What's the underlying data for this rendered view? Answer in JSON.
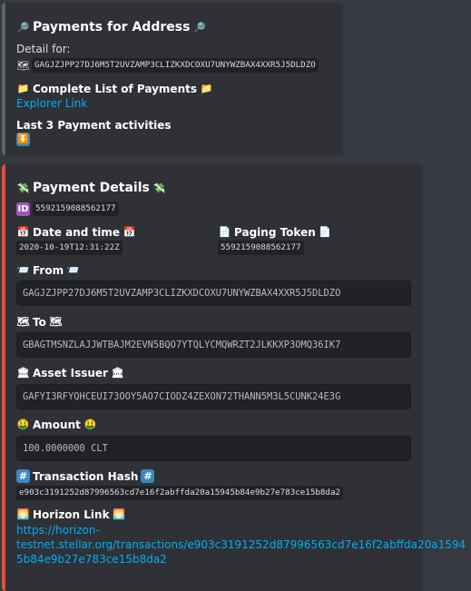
{
  "card1": {
    "title": "Payments for Address",
    "title_icon": "magnifier-icon",
    "detail_label": "Detail for:",
    "address_icon": "world-map-icon",
    "address": "GAGJZJPP27DJ6M5T2UVZAMP3CLIZKXDCOXU7UNYWZBAX4XXR5J5DLDZO",
    "list_title": "Complete List of Payments",
    "list_icon": "folder-icon",
    "explorer_link": "Explorer Link",
    "last_label": "Last 3 Payment activities",
    "last_icon": "double-down-arrow-icon"
  },
  "card2": {
    "accent_color": "#e74c3c",
    "title": "Payment Details",
    "title_icon": "money-with-wings-icon",
    "id_icon": "id-icon",
    "id": "5592159088562177",
    "date_label": "Date and time",
    "date_icon": "calendar-icon",
    "date_value": "2020-10-19T12:31:22Z",
    "paging_label": "Paging Token",
    "paging_icon": "page-icon",
    "paging_value": "5592159088562177",
    "from_label": "From",
    "from_icon": "incoming-envelope-icon",
    "from_value": "GAGJZJPP27DJ6M5T2UVZAMP3CLIZKXDCOXU7UNYWZBAX4XXR5J5DLDZO",
    "to_label": "To",
    "to_icon": "world-map-icon",
    "to_value": "GBAGTMSNZLAJJWTBAJM2EVN5BQO7YTQLYCMQWRZT2JLKKXP3OMQ36IK7",
    "issuer_label": "Asset Issuer",
    "issuer_icon": "bank-icon",
    "issuer_value": "GAFYI3RFYQHCEUI73OOY5AO7CIODZ4ZEXON72THANN5M3L5CUNK24E3G",
    "amount_label": "Amount",
    "amount_icon": "money-mouth-face-icon",
    "amount_value": "100.0000000 CLT",
    "hash_label": "Transaction Hash",
    "hash_icon": "hash-icon",
    "hash_value": "e903c3191252d87996563cd7e16f2abffda20a15945b84e9b27e783ce15b8da2",
    "horizon_label": "Horizon Link",
    "horizon_icon": "sunrise-icon",
    "horizon_link_line1": "https://horizon-",
    "horizon_link_line2": "testnet.stellar.org/transactions/e903c3191252d87996563cd7e16f2abffda20a1594",
    "horizon_link_line3": "5b84e9b27e783ce15b8da2"
  }
}
